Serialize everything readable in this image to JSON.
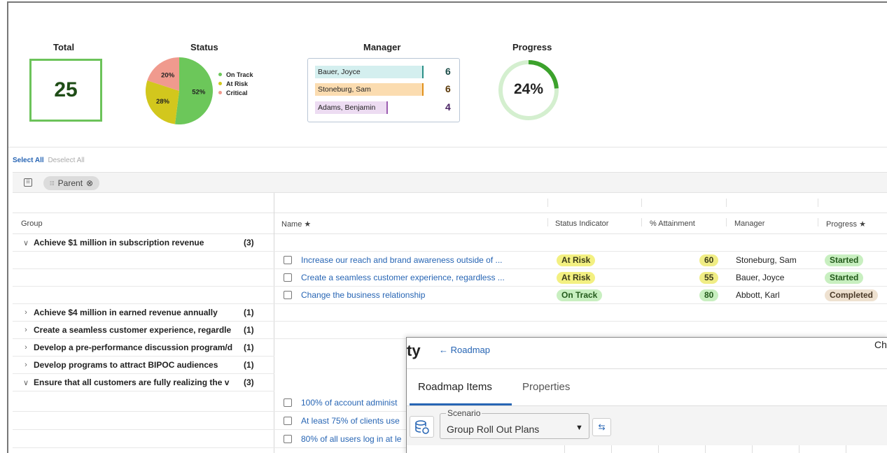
{
  "widgets": {
    "total": {
      "title": "Total",
      "value": "25"
    },
    "status": {
      "title": "Status",
      "slices": [
        {
          "label": "On Track",
          "percent": 52,
          "pct_label": "52%",
          "color": "#6cc75a"
        },
        {
          "label": "At Risk",
          "percent": 28,
          "pct_label": "28%",
          "color": "#d2c71d"
        },
        {
          "label": "Critical",
          "percent": 20,
          "pct_label": "20%",
          "color": "#f09a8e"
        }
      ]
    },
    "manager": {
      "title": "Manager",
      "rows": [
        {
          "name": "Bauer, Joyce",
          "count": "6",
          "bg": "#d4efef",
          "bar": "#2a8f86",
          "count_color": "#1a4b47"
        },
        {
          "name": "Stoneburg, Sam",
          "count": "6",
          "bg": "#fbdcb0",
          "bar": "#e1901b",
          "count_color": "#5a3808"
        },
        {
          "name": "Adams, Benjamin",
          "count": "4",
          "bg": "#eddcf2",
          "bar": "#9b5db0",
          "count_color": "#4a2464"
        }
      ]
    },
    "progress": {
      "title": "Progress",
      "value": "24%",
      "fraction": 0.24,
      "color": "#3ca22c",
      "track": "#d4efcf"
    }
  },
  "select_all": "Select All",
  "deselect_all": "Deselect All",
  "filter_chip": {
    "label": "Parent",
    "remove_icon": "⊗"
  },
  "columns": {
    "group": "Group",
    "name": "Name ★",
    "status": "Status Indicator",
    "attainment": "% Attainment",
    "manager": "Manager",
    "progress": "Progress ★"
  },
  "groups": [
    {
      "name": "Achieve $1 million in subscription revenue",
      "count": "(3)",
      "expanded": true
    },
    {
      "name": "Achieve $4 million in earned revenue annually",
      "count": "(1)",
      "expanded": false
    },
    {
      "name": "Create a seamless customer experience, regardle",
      "count": "(1)",
      "expanded": false
    },
    {
      "name": "Develop a pre-performance discussion program/d",
      "count": "(1)",
      "expanded": false
    },
    {
      "name": "Develop programs to attract BIPOC audiences",
      "count": "(1)",
      "expanded": false
    },
    {
      "name": "Ensure that all customers are fully realizing the v",
      "count": "(3)",
      "expanded": true
    }
  ],
  "rows": [
    {
      "name": "Increase our reach and brand awareness outside of ...",
      "status": "At Risk",
      "attainment": "60",
      "manager": "Stoneburg, Sam",
      "progress": "Started"
    },
    {
      "name": "Create a seamless customer experience, regardless ...",
      "status": "At Risk",
      "attainment": "55",
      "manager": "Bauer, Joyce",
      "progress": "Started"
    },
    {
      "name": "Change the business relationship",
      "status": "On Track",
      "attainment": "80",
      "manager": "Abbott, Karl",
      "progress": "Completed"
    }
  ],
  "rows2": [
    {
      "name": "100% of account administ"
    },
    {
      "name": "At least 75% of clients use"
    },
    {
      "name": "80% of all users log in at le"
    }
  ],
  "overlay": {
    "title_fragment": "ty",
    "back_link": "← Roadmap",
    "corner_fragment": "Ch",
    "tabs": [
      "Roadmap Items",
      "Properties"
    ],
    "scenario_label": "Scenario",
    "scenario_value": "Group Roll Out Plans",
    "icons": {
      "db": "database-refresh-icon",
      "swap": "swap-icon",
      "caret": "caret-down-icon"
    }
  }
}
